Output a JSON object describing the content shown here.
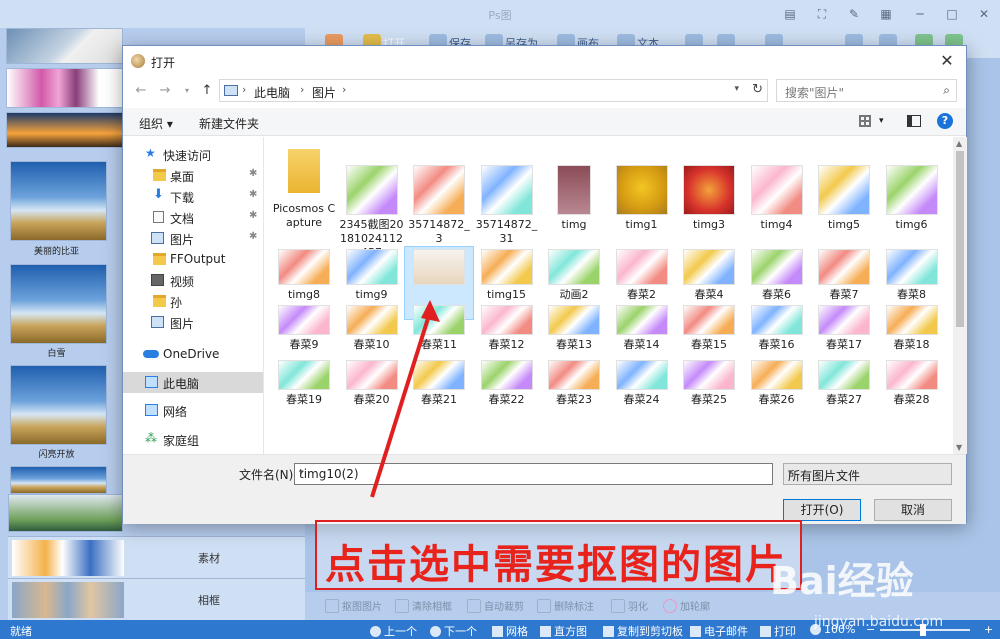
{
  "app": {
    "title": "Ps图",
    "toolbar": [
      "打开",
      "保存",
      "另存为",
      "画布",
      "文本"
    ],
    "left_captions": [
      "美丽的比亚",
      "白雪",
      "闪亮开放"
    ],
    "categories": [
      "素材",
      "相框"
    ],
    "bottom_tools": [
      "抠图图片",
      "清除相框",
      "自动裁剪",
      "删除标注",
      "羽化",
      "加轮廓"
    ],
    "status": {
      "ready": "就绪",
      "prev": "上一个",
      "next": "下一个",
      "grid": "网格",
      "histogram": "直方图",
      "copy_clipboard": "复制到剪切板",
      "email": "电子邮件",
      "print": "打印",
      "zoom": "100%"
    }
  },
  "dialog": {
    "title": "打开",
    "address": [
      "此电脑",
      "图片"
    ],
    "search_placeholder": "搜索\"图片\"",
    "organize": "组织 ▾",
    "new_folder": "新建文件夹",
    "nav": {
      "quick_access": "快速访问",
      "items": [
        {
          "label": "桌面",
          "pinned": true
        },
        {
          "label": "下载",
          "pinned": true
        },
        {
          "label": "文档",
          "pinned": true
        },
        {
          "label": "图片",
          "pinned": true
        },
        {
          "label": "FFOutput",
          "pinned": false
        },
        {
          "label": "视频",
          "pinned": false
        },
        {
          "label": "孙",
          "pinned": false
        },
        {
          "label": "图片",
          "pinned": false
        }
      ],
      "onedrive": "OneDrive",
      "this_pc": "此电脑",
      "network": "网络",
      "homegroup": "家庭组"
    },
    "files": [
      {
        "name": "Picosmos Capture",
        "kind": "folder"
      },
      {
        "name": "2345截图20181024112457",
        "kind": "image"
      },
      {
        "name": "35714872_3",
        "kind": "image"
      },
      {
        "name": "35714872_31",
        "kind": "image"
      },
      {
        "name": "timg",
        "kind": "image"
      },
      {
        "name": "timg1",
        "kind": "image"
      },
      {
        "name": "timg3",
        "kind": "image"
      },
      {
        "name": "timg4",
        "kind": "image"
      },
      {
        "name": "timg5",
        "kind": "image"
      },
      {
        "name": "timg6",
        "kind": "image"
      },
      {
        "name": "timg8",
        "kind": "image"
      },
      {
        "name": "timg9",
        "kind": "image"
      },
      {
        "name": "timg10(2)",
        "kind": "image",
        "selected": true
      },
      {
        "name": "timg15",
        "kind": "image"
      },
      {
        "name": "动画2",
        "kind": "image"
      },
      {
        "name": "春菜2",
        "kind": "image"
      },
      {
        "name": "春菜4",
        "kind": "image"
      },
      {
        "name": "春菜6",
        "kind": "image"
      },
      {
        "name": "春菜7",
        "kind": "image"
      },
      {
        "name": "春菜8",
        "kind": "image"
      },
      {
        "name": "春菜9",
        "kind": "image"
      },
      {
        "name": "春菜10",
        "kind": "image"
      },
      {
        "name": "春菜11",
        "kind": "image"
      },
      {
        "name": "春菜12",
        "kind": "image"
      },
      {
        "name": "春菜13",
        "kind": "image"
      },
      {
        "name": "春菜14",
        "kind": "image"
      },
      {
        "name": "春菜15",
        "kind": "image"
      },
      {
        "name": "春菜16",
        "kind": "image"
      },
      {
        "name": "春菜17",
        "kind": "image"
      },
      {
        "name": "春菜18",
        "kind": "image"
      },
      {
        "name": "春菜19",
        "kind": "image"
      },
      {
        "name": "春菜20",
        "kind": "image"
      },
      {
        "name": "春菜21",
        "kind": "image"
      },
      {
        "name": "春菜22",
        "kind": "image"
      },
      {
        "name": "春菜23",
        "kind": "image"
      },
      {
        "name": "春菜24",
        "kind": "image"
      },
      {
        "name": "春菜25",
        "kind": "image"
      },
      {
        "name": "春菜26",
        "kind": "image"
      },
      {
        "name": "春菜27",
        "kind": "image"
      },
      {
        "name": "春菜28",
        "kind": "image"
      }
    ],
    "filename_label": "文件名(N):",
    "filename_value": "timg10(2)",
    "filetype": "所有图片文件",
    "open_button": "打开(O)",
    "cancel_button": "取消"
  },
  "annotation": {
    "text": "点击选中需要抠图的图片",
    "color": "#e8231c"
  },
  "watermark": {
    "brand": "Bai经验",
    "url": "jingyan.baidu.com"
  }
}
